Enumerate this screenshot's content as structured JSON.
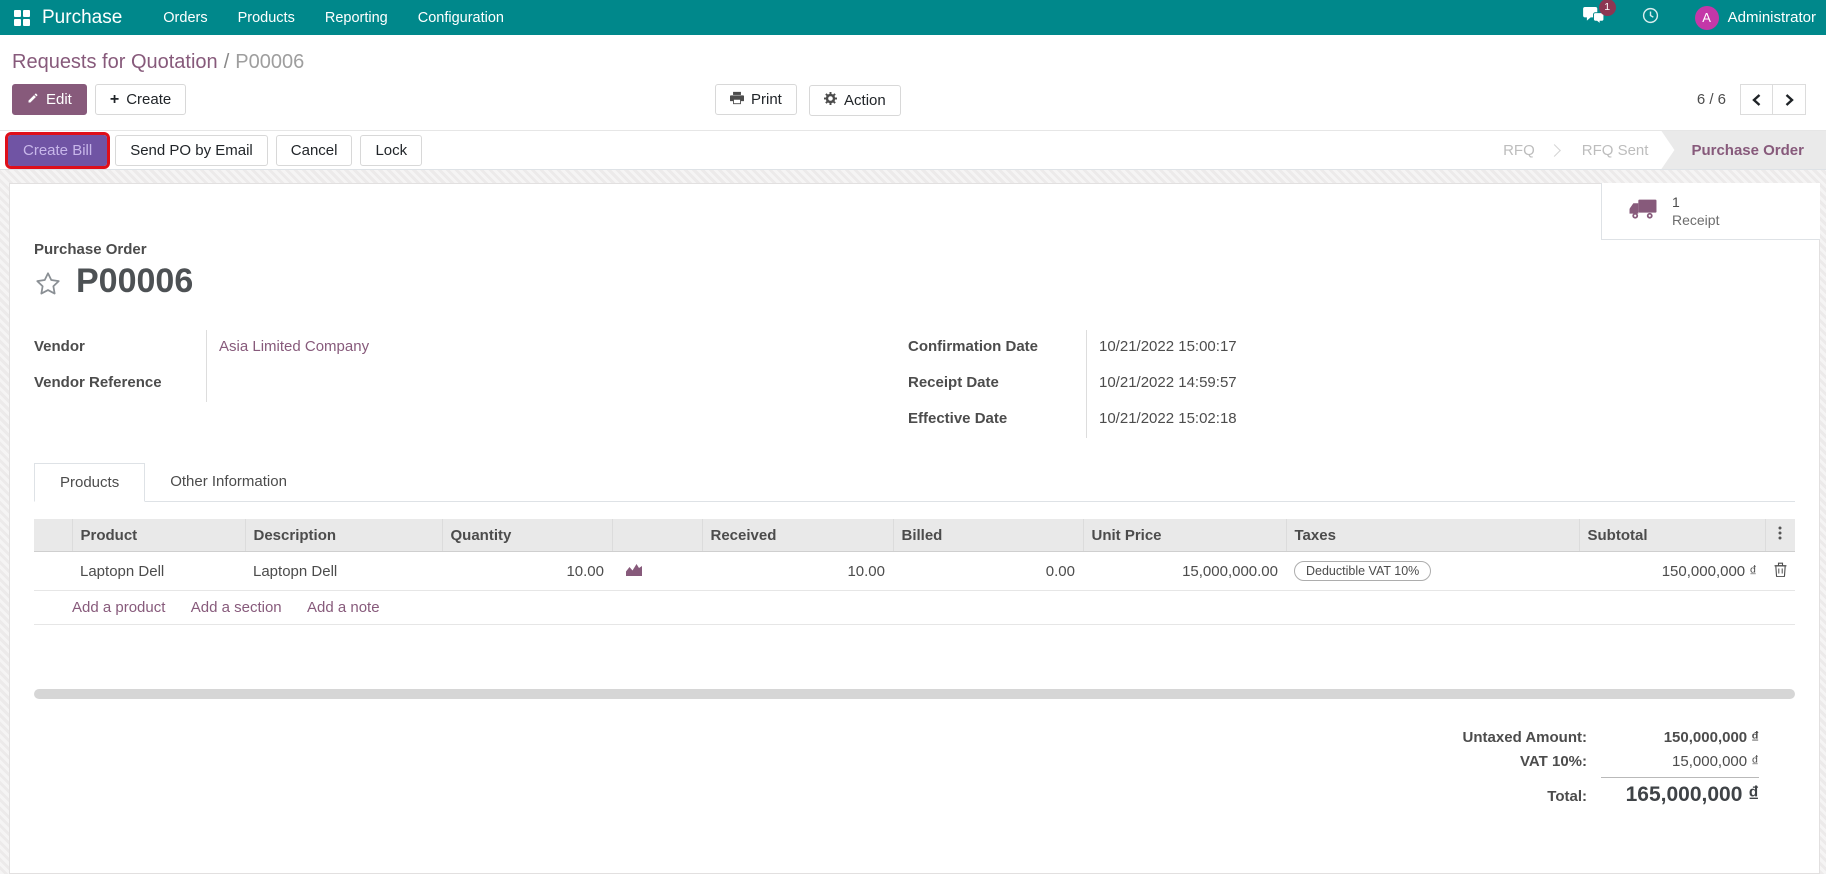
{
  "colors": {
    "navbar_bg": "#00888B",
    "primary_purple": "#875A7B",
    "create_bill_bg": "#7054A4",
    "highlight_red": "#DF0F1A",
    "avatar_bg": "#C437A8",
    "badge_bg": "#8C3652",
    "stage_active_bg": "#EAEAEA",
    "table_header_bg": "#E9E9E9"
  },
  "navbar": {
    "app_name": "Purchase",
    "menus": [
      "Orders",
      "Products",
      "Reporting",
      "Configuration"
    ],
    "messages_badge": "1",
    "user_initial": "A",
    "user_name": "Administrator"
  },
  "breadcrumb": {
    "parent": "Requests for Quotation",
    "separator": "/",
    "current": "P00006"
  },
  "control_panel": {
    "edit_label": "Edit",
    "create_label": "Create",
    "print_label": "Print",
    "action_label": "Action",
    "pager": "6 / 6"
  },
  "statusbar": {
    "action_buttons": [
      {
        "label": "Create Bill"
      },
      {
        "label": "Send PO by Email"
      },
      {
        "label": "Cancel"
      },
      {
        "label": "Lock"
      }
    ],
    "stages": [
      {
        "label": "RFQ"
      },
      {
        "label": "RFQ Sent"
      },
      {
        "label": "Purchase Order"
      }
    ]
  },
  "sheet": {
    "stat_button": {
      "count": "1",
      "label": "Receipt"
    },
    "title_label": "Purchase Order",
    "order_number": "P00006",
    "fields_left": [
      {
        "label": "Vendor",
        "value": "Asia Limited Company"
      },
      {
        "label": "Vendor Reference",
        "value": ""
      }
    ],
    "fields_right": [
      {
        "label": "Confirmation Date",
        "value": "10/21/2022 15:00:17"
      },
      {
        "label": "Receipt Date",
        "value": "10/21/2022 14:59:57"
      },
      {
        "label": "Effective Date",
        "value": "10/21/2022 15:02:18"
      }
    ],
    "tabs": [
      {
        "label": "Products"
      },
      {
        "label": "Other Information"
      }
    ],
    "lines_table": {
      "headers": {
        "product": "Product",
        "description": "Description",
        "quantity": "Quantity",
        "received": "Received",
        "billed": "Billed",
        "unit_price": "Unit Price",
        "taxes": "Taxes",
        "subtotal": "Subtotal"
      },
      "rows": [
        {
          "product": "Laptopn Dell",
          "description": "Laptopn Dell",
          "quantity": "10.00",
          "received": "10.00",
          "billed": "0.00",
          "unit_price": "15,000,000.00",
          "taxes": "Deductible VAT 10%",
          "subtotal": "150,000,000 ₫"
        }
      ],
      "links": [
        "Add a product",
        "Add a section",
        "Add a note"
      ]
    },
    "totals": {
      "untaxed_label": "Untaxed Amount:",
      "untaxed_value": "150,000,000 ₫",
      "tax_label": "VAT 10%:",
      "tax_value": "15,000,000 ₫",
      "total_label": "Total:",
      "total_value": "165,000,000 ₫"
    }
  },
  "icons": {
    "plus": "+"
  }
}
